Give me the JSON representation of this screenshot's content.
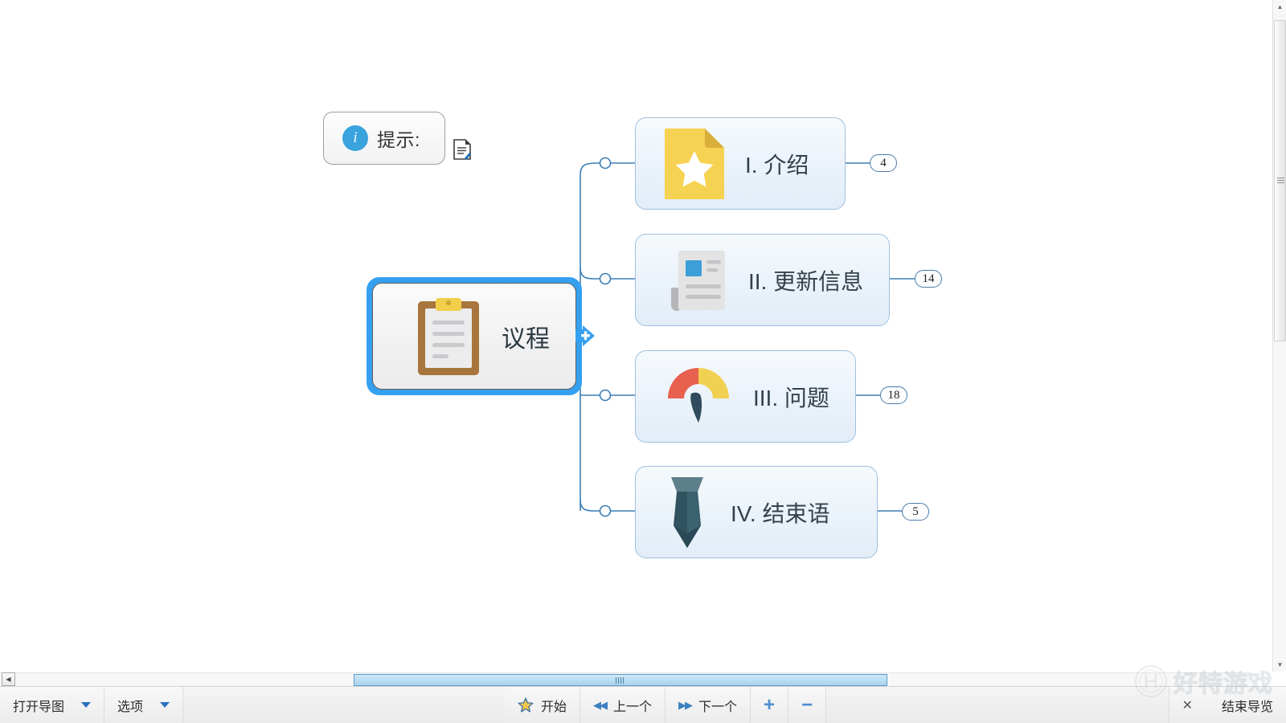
{
  "app": {
    "canvas_background": "#ffffff",
    "accent_color": "#36a0f0",
    "branch_border_color": "#9ec0dd",
    "connector_color": "#3d7fb5"
  },
  "tip": {
    "icon": "info-circle-icon",
    "label": "提示:",
    "note_icon": "note-edit-icon"
  },
  "mindmap": {
    "central": {
      "label": "议程",
      "icon": "clipboard-icon",
      "selected": true,
      "expand_handle": "plus-handle"
    },
    "branches": [
      {
        "label": "I. 介绍",
        "icon": "star-document-icon",
        "badge": "4"
      },
      {
        "label": "II. 更新信息",
        "icon": "newspaper-icon",
        "badge": "14"
      },
      {
        "label": "III. 问题",
        "icon": "gauge-icon",
        "badge": "18"
      },
      {
        "label": "IV. 结束语",
        "icon": "necktie-icon",
        "badge": "5"
      }
    ]
  },
  "scrollbars": {
    "vertical_up_icon": "triangle-up-icon",
    "vertical_down_icon": "triangle-down-icon",
    "horizontal_grip": "grip-icon",
    "corner_collapse_icon": "triangle-left-icon"
  },
  "toolbar": {
    "open_map": "打开导图",
    "options": "选项",
    "start": "开始",
    "previous": "上一个",
    "next": "下一个",
    "zoom_in": "+",
    "zoom_out": "−",
    "end_tour": "结束导览",
    "close_icon": "x-icon",
    "start_icon": "star-icon",
    "prev_icon": "double-arrow-left-icon",
    "next_icon": "double-arrow-right-icon",
    "dropdown_icon": "caret-down-icon"
  },
  "watermark": {
    "logo": "h-circle-icon",
    "text": "好特游戏"
  }
}
